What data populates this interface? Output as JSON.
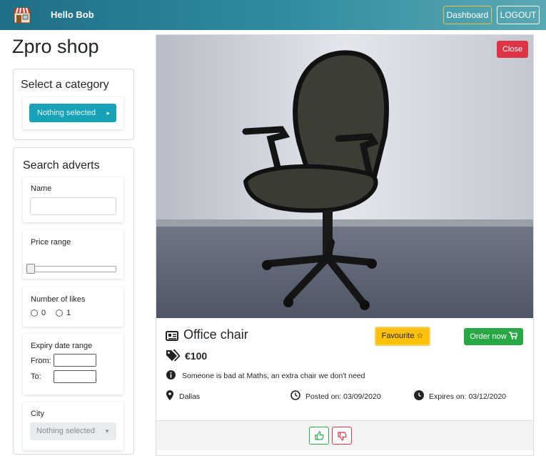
{
  "header": {
    "greeting": "Hello Bob",
    "dashboard_label": "Dashboard",
    "logout_label": "LOGOUT"
  },
  "sidebar": {
    "shop_title": "Zpro shop",
    "category": {
      "heading": "Select a category",
      "selected": "Nothing selected"
    },
    "search": {
      "heading": "Search adverts",
      "name_label": "Name",
      "name_value": "",
      "price_label": "Price range",
      "price_value": 0,
      "likes_label": "Number of likes",
      "likes_options": [
        "0",
        "1"
      ],
      "expiry_label": "Expiry date range",
      "from_label": "From:",
      "to_label": "To:",
      "city_label": "City",
      "city_selected": "Nothing selected"
    }
  },
  "advert": {
    "close_label": "Close",
    "title": "Office chair",
    "price": "€100",
    "favourite_label": "Favourite",
    "order_label": "Order now",
    "description": "Someone is bad at Maths, an extra chair we don't need",
    "location": "Dallas",
    "posted": "Posted on: 03/09/2020",
    "expires": "Expires on: 03/12/2020"
  },
  "colors": {
    "header_start": "#1f6f86",
    "header_end": "#5aa9b4",
    "info": "#17a2b8",
    "danger": "#dc3545",
    "warning": "#ffc107",
    "success": "#28a745"
  },
  "icons": [
    "shop-icon",
    "chevron-right-icon",
    "newspaper-icon",
    "tags-icon",
    "star-icon",
    "cart-icon",
    "info-icon",
    "map-marker-icon",
    "clock-icon",
    "thumbs-up-icon",
    "thumbs-down-icon",
    "caret-down-icon"
  ]
}
